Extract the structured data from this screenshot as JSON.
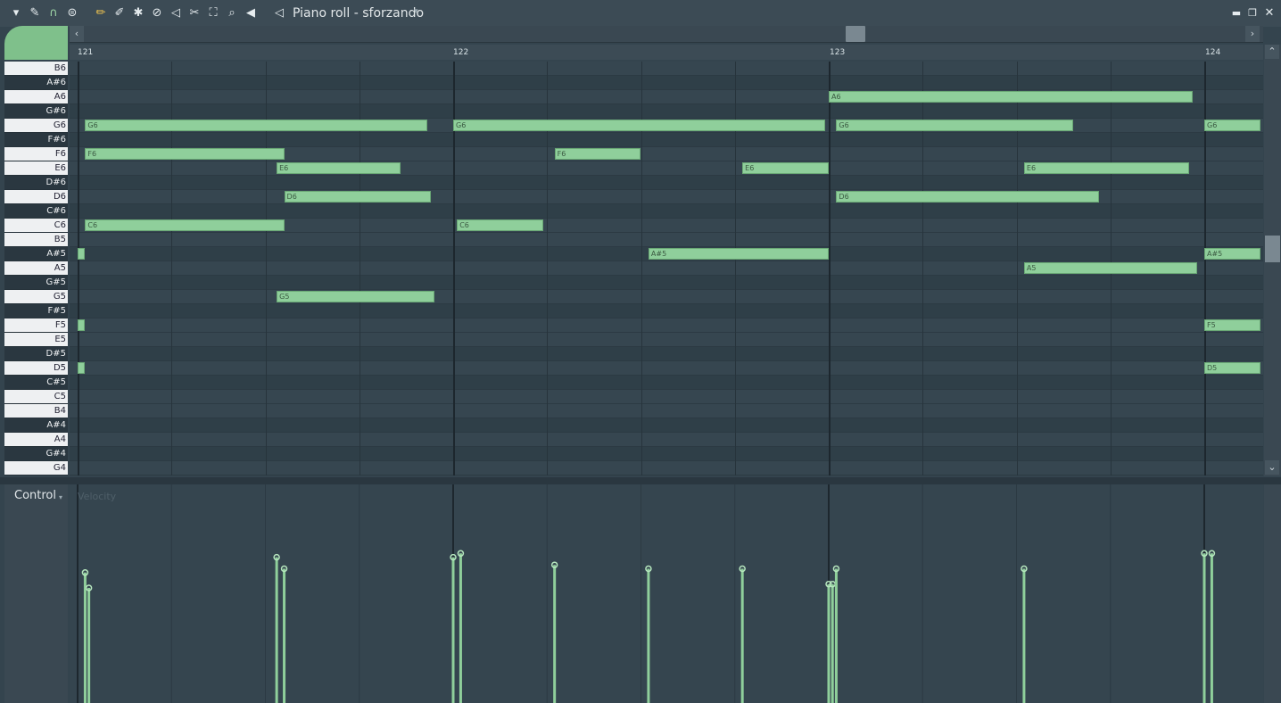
{
  "window": {
    "title": "Piano roll - sforzando",
    "toolbar_icons": [
      "menu-arrow-icon",
      "wrench-icon",
      "magnet-icon",
      "snap-icon",
      "pencil-icon",
      "brush-icon",
      "paint-icon",
      "delete-icon",
      "mute-icon",
      "slice-icon",
      "select-icon",
      "zoom-icon",
      "playback-icon",
      "speaker-icon"
    ],
    "controls": [
      "minimize-icon",
      "restore-icon",
      "close-icon"
    ]
  },
  "ruler": {
    "bars": [
      "121",
      "122",
      "123",
      "124"
    ]
  },
  "keys": [
    "B6",
    "A#6",
    "A6",
    "G#6",
    "G6",
    "F#6",
    "F6",
    "E6",
    "D#6",
    "D6",
    "C#6",
    "C6",
    "B5",
    "A#5",
    "A5",
    "G#5",
    "G5",
    "F#5",
    "F5",
    "E5",
    "D#5",
    "D5",
    "C#5",
    "C5",
    "B4",
    "A#4",
    "A4",
    "G#4",
    "G4"
  ],
  "notes": [
    {
      "label": "A6",
      "pitch": "A6",
      "start": 123.0,
      "end": 123.97
    },
    {
      "label": "G6",
      "pitch": "G6",
      "start": 121.02,
      "end": 121.93
    },
    {
      "label": "G6",
      "pitch": "G6",
      "start": 122.0,
      "end": 122.99
    },
    {
      "label": "G6",
      "pitch": "G6",
      "start": 123.02,
      "end": 123.65
    },
    {
      "label": "G6",
      "pitch": "G6",
      "start": 124.0,
      "end": 124.15
    },
    {
      "label": "F6",
      "pitch": "F6",
      "start": 121.02,
      "end": 121.55
    },
    {
      "label": "F6",
      "pitch": "F6",
      "start": 122.27,
      "end": 122.5
    },
    {
      "label": "E6",
      "pitch": "E6",
      "start": 121.53,
      "end": 121.86
    },
    {
      "label": "E6",
      "pitch": "E6",
      "start": 122.77,
      "end": 123.0
    },
    {
      "label": "E6",
      "pitch": "E6",
      "start": 123.52,
      "end": 123.96
    },
    {
      "label": "D6",
      "pitch": "D6",
      "start": 121.55,
      "end": 121.94
    },
    {
      "label": "D6",
      "pitch": "D6",
      "start": 123.02,
      "end": 123.72
    },
    {
      "label": "C6",
      "pitch": "C6",
      "start": 121.02,
      "end": 121.55
    },
    {
      "label": "C6",
      "pitch": "C6",
      "start": 122.01,
      "end": 122.24
    },
    {
      "label": "",
      "pitch": "A#5",
      "start": 121.0,
      "end": 121.02
    },
    {
      "label": "A#5",
      "pitch": "A#5",
      "start": 122.52,
      "end": 123.0
    },
    {
      "label": "A#5",
      "pitch": "A#5",
      "start": 124.0,
      "end": 124.15
    },
    {
      "label": "A5",
      "pitch": "A5",
      "start": 123.52,
      "end": 123.98
    },
    {
      "label": "G5",
      "pitch": "G5",
      "start": 121.53,
      "end": 121.95
    },
    {
      "label": "",
      "pitch": "F5",
      "start": 121.0,
      "end": 121.02
    },
    {
      "label": "F5",
      "pitch": "F5",
      "start": 124.0,
      "end": 124.15
    },
    {
      "label": "",
      "pitch": "D5",
      "start": 121.0,
      "end": 121.02
    },
    {
      "label": "D5",
      "pitch": "D5",
      "start": 124.0,
      "end": 124.15
    }
  ],
  "control": {
    "label": "Control",
    "target": "Velocity",
    "velocities": [
      {
        "t": 121.02,
        "v": 0.34
      },
      {
        "t": 121.03,
        "v": 0.3
      },
      {
        "t": 121.53,
        "v": 0.38
      },
      {
        "t": 121.55,
        "v": 0.35
      },
      {
        "t": 122.0,
        "v": 0.38
      },
      {
        "t": 122.02,
        "v": 0.39
      },
      {
        "t": 122.27,
        "v": 0.36
      },
      {
        "t": 122.52,
        "v": 0.35
      },
      {
        "t": 122.77,
        "v": 0.35
      },
      {
        "t": 123.0,
        "v": 0.31
      },
      {
        "t": 123.01,
        "v": 0.31
      },
      {
        "t": 123.02,
        "v": 0.35
      },
      {
        "t": 123.52,
        "v": 0.35
      },
      {
        "t": 124.0,
        "v": 0.39
      },
      {
        "t": 124.02,
        "v": 0.39
      }
    ]
  }
}
